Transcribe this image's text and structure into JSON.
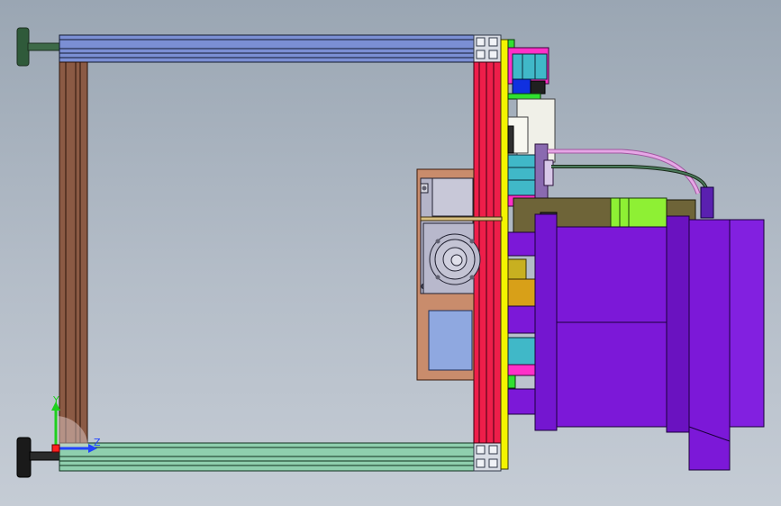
{
  "viewport": {
    "background_top": "#9aa6b3",
    "background_bottom": "#c5ccd5"
  },
  "triad": {
    "y_label": "Y",
    "z_label": "Z",
    "y_color": "#1ed01e",
    "z_color": "#2244ff"
  },
  "colors": {
    "frame_top_rail": "#7b8fd4",
    "frame_bottom_rail": "#8fcfae",
    "frame_left_post": "#8b5a44",
    "plate_red": "#ee1e4a",
    "plate_yellow": "#f4f400",
    "motor_plate": "#c98c6c",
    "motor": "#b4b4c8",
    "lens_purple": "#7c18d8",
    "hose_pink": "#e6a6e6",
    "cable_green": "#2a5a3a",
    "lime": "#8ef034",
    "olive": "#6e6438",
    "cyan": "#40b8c8",
    "magenta": "#ff30c8",
    "blue_block": "#1030e0",
    "feet": "#2f5a3a",
    "feet_dark": "#1a1a1a"
  }
}
